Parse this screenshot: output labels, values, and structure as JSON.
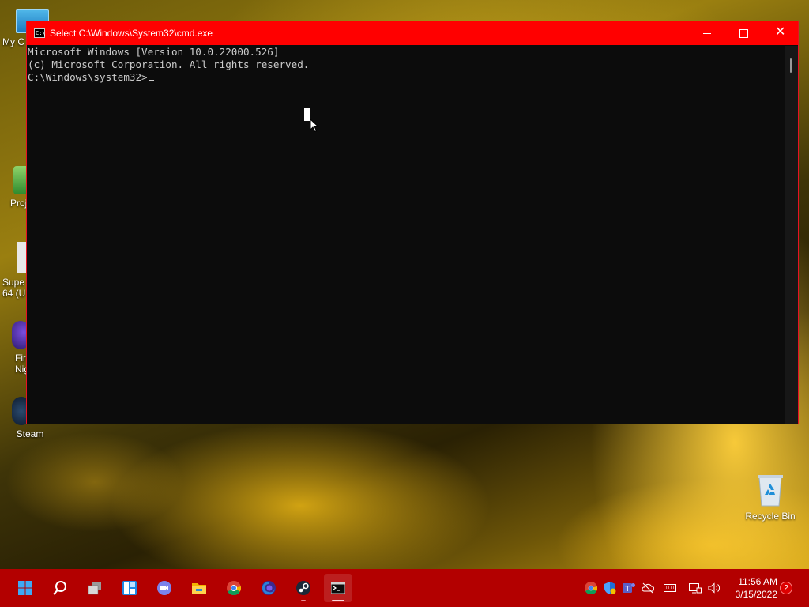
{
  "desktop": {
    "icons": [
      {
        "name": "my-computer",
        "label": "My C"
      },
      {
        "name": "proj-shortcut",
        "label": "Proj"
      },
      {
        "name": "super-64",
        "label": "Supe\n64 (U"
      },
      {
        "name": "firefox-nightly",
        "label": "Fir\nNig"
      },
      {
        "name": "steam",
        "label": "Steam"
      },
      {
        "name": "recycle-bin",
        "label": "Recycle Bin"
      }
    ]
  },
  "window": {
    "title": "Select C:\\Windows\\System32\\cmd.exe",
    "icon": "cmd-icon",
    "controls": {
      "minimize": "minimize-icon",
      "maximize": "maximize-icon",
      "close": "close-icon"
    }
  },
  "console": {
    "lines": [
      "Microsoft Windows [Version 10.0.22000.526]",
      "(c) Microsoft Corporation. All rights reserved.",
      "C:\\Windows\\system32>"
    ]
  },
  "taskbar": {
    "apps": [
      {
        "name": "start",
        "icon": "windows-logo-icon"
      },
      {
        "name": "search",
        "icon": "search-icon"
      },
      {
        "name": "task-view",
        "icon": "task-view-icon"
      },
      {
        "name": "widgets",
        "icon": "widgets-icon"
      },
      {
        "name": "chat",
        "icon": "teams-chat-icon"
      },
      {
        "name": "file-explorer",
        "icon": "folder-icon"
      },
      {
        "name": "chrome",
        "icon": "chrome-icon"
      },
      {
        "name": "firefox",
        "icon": "firefox-icon"
      },
      {
        "name": "steam",
        "icon": "steam-icon"
      },
      {
        "name": "cmd",
        "icon": "terminal-icon"
      }
    ],
    "tray_icons": [
      "chrome-icon",
      "security-shield-icon",
      "teams-icon",
      "onedrive-icon",
      "keyboard-icon",
      "display-icon",
      "volume-icon"
    ],
    "clock": {
      "time": "11:56 AM",
      "date": "3/15/2022"
    },
    "notification_count": "2"
  },
  "colors": {
    "accent": "#ff0000",
    "taskbar": "#b30000",
    "console_bg": "#0c0c0c",
    "console_text": "#cccccc"
  }
}
